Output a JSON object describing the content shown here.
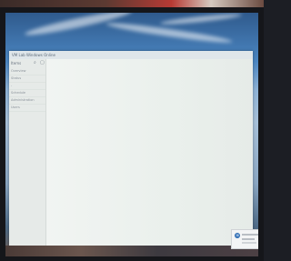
{
  "window": {
    "title": "VM Lab Windows Online"
  },
  "sidebar": {
    "title": "Items",
    "icons": [
      "search-icon",
      "grid-icon"
    ],
    "items": [
      {
        "label": "Overview"
      },
      {
        "label": "Status"
      },
      {
        "label": "-"
      },
      {
        "label": "Schedule"
      },
      {
        "label": "Administration"
      },
      {
        "label": "Users"
      }
    ]
  },
  "toast": {
    "icon": "windows-icon"
  }
}
